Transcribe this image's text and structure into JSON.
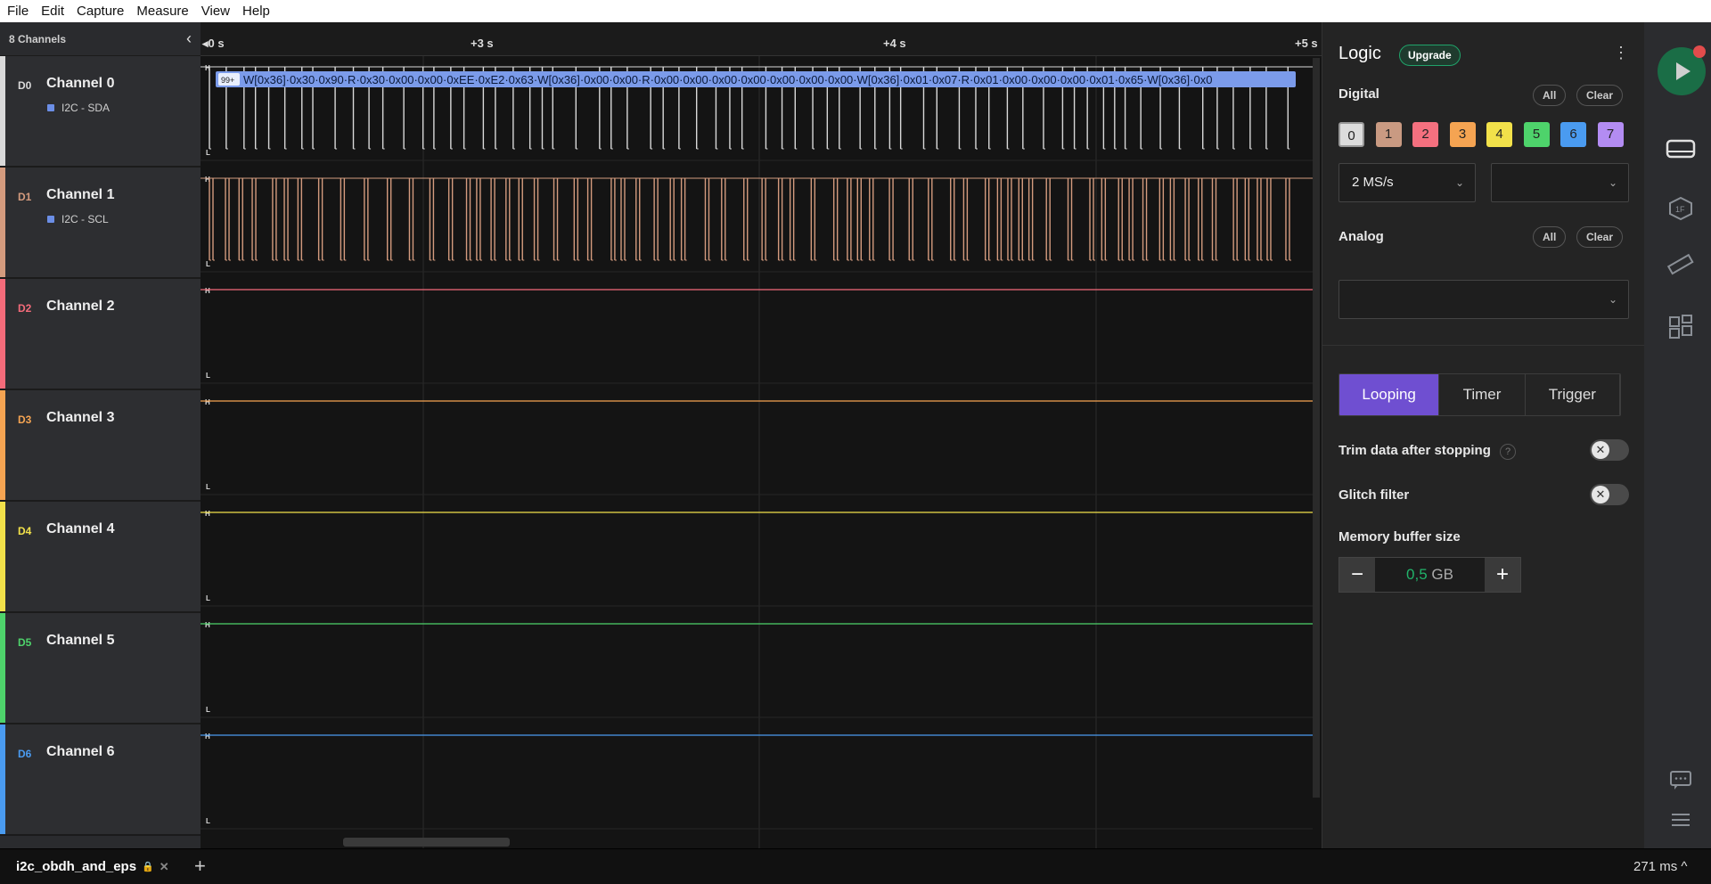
{
  "menu": [
    "File",
    "Edit",
    "Capture",
    "Measure",
    "View",
    "Help"
  ],
  "channels_panel": {
    "title": "8 Channels",
    "channels": [
      {
        "code": "D0",
        "name": "Channel 0",
        "color": "#d9d9d9",
        "analyzer": "I2C - SDA",
        "level": "H-idle",
        "activity": "sda"
      },
      {
        "code": "D1",
        "name": "Channel 1",
        "color": "#d49b7e",
        "analyzer": "I2C - SCL",
        "level": "H-idle",
        "activity": "scl"
      },
      {
        "code": "D2",
        "name": "Channel 2",
        "color": "#f46b7a",
        "analyzer": "",
        "level": "H",
        "activity": "none"
      },
      {
        "code": "D3",
        "name": "Channel 3",
        "color": "#f5a452",
        "analyzer": "",
        "level": "H",
        "activity": "none"
      },
      {
        "code": "D4",
        "name": "Channel 4",
        "color": "#f2e14a",
        "analyzer": "",
        "level": "H",
        "activity": "none"
      },
      {
        "code": "D5",
        "name": "Channel 5",
        "color": "#4ed36b",
        "analyzer": "",
        "level": "H",
        "activity": "none"
      },
      {
        "code": "D6",
        "name": "Channel 6",
        "color": "#4a9bf0",
        "analyzer": "",
        "level": "H",
        "activity": "none"
      }
    ]
  },
  "timeline": {
    "ticks": [
      "0 s",
      "+3 s",
      "+4 s",
      "+5 s"
    ]
  },
  "decode": {
    "badge": "99+",
    "text": "W[0x36]·0x30·0x90·R·0x30·0x00·0x00·0xEE·0xE2·0x63·W[0x36]·0x00·0x00·R·0x00·0x00·0x00·0x00·0x00·0x00·0x00·W[0x36]·0x01·0x07·R·0x01·0x00·0x00·0x00·0x01·0x65·W[0x36]·0x0"
  },
  "level_labels": {
    "high": "H",
    "low": "L"
  },
  "side": {
    "title": "Logic",
    "upgrade": "Upgrade",
    "digital_label": "Digital",
    "all": "All",
    "clear": "Clear",
    "digital_chips": [
      {
        "label": "0",
        "color": "#dcdcdc"
      },
      {
        "label": "1",
        "color": "#c99a82"
      },
      {
        "label": "2",
        "color": "#f4707f"
      },
      {
        "label": "3",
        "color": "#f5a452"
      },
      {
        "label": "4",
        "color": "#f2e14a"
      },
      {
        "label": "5",
        "color": "#4ed36b"
      },
      {
        "label": "6",
        "color": "#4a9bf0"
      },
      {
        "label": "7",
        "color": "#b38cf2"
      }
    ],
    "sample_rate": "2 MS/s",
    "voltage": "",
    "analog_label": "Analog",
    "analog_rate": "",
    "modes": [
      "Looping",
      "Timer",
      "Trigger"
    ],
    "active_mode": "Looping",
    "trim_label": "Trim data after stopping",
    "glitch_label": "Glitch filter",
    "memory_label": "Memory buffer size",
    "memory_value": "0,5",
    "memory_unit": "GB"
  },
  "status": {
    "tab_name": "i2c_obdh_and_eps",
    "latency": "271 ms ^"
  }
}
